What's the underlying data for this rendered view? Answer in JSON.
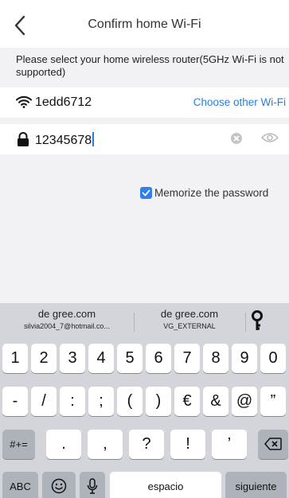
{
  "header": {
    "title": "Confirm home Wi-Fi",
    "back_icon": "chevron-left-icon"
  },
  "notice": "Please select your home wireless router(5GHz Wi-Fi is not supported)",
  "wifi": {
    "ssid": "1edd6712",
    "choose_label": "Choose other Wi-Fi",
    "icon": "wifi-icon"
  },
  "password": {
    "value": "12345678",
    "icon": "lock-icon",
    "clear_icon": "clear-icon",
    "visibility_icon": "eye-icon"
  },
  "memorize": {
    "label": "Memorize the password",
    "checked": true
  },
  "keyboard": {
    "suggestions": [
      {
        "main": "de gree.com",
        "sub": "silvia2004_7@hotmail.co..."
      },
      {
        "main": "de gree.com",
        "sub": "VG_EXTERNAL"
      }
    ],
    "suggestion_icon": "key-icon",
    "row1": [
      "1",
      "2",
      "3",
      "4",
      "5",
      "6",
      "7",
      "8",
      "9",
      "0"
    ],
    "row2": [
      "-",
      "/",
      ":",
      ";",
      "(",
      ")",
      "€",
      "&",
      "@",
      "”"
    ],
    "row3_left": "#+=",
    "row3": [
      ".",
      ",",
      "?",
      "!",
      "’"
    ],
    "row3_right_icon": "backspace-icon",
    "row4": {
      "abc": "ABC",
      "emoji_icon": "emoji-icon",
      "mic_icon": "microphone-icon",
      "space": "espacio",
      "next": "siguiente"
    }
  },
  "colors": {
    "accent": "#2a7fd4",
    "checkbox": "#2f80ed",
    "keyboard_bg": "#d3d5db"
  }
}
